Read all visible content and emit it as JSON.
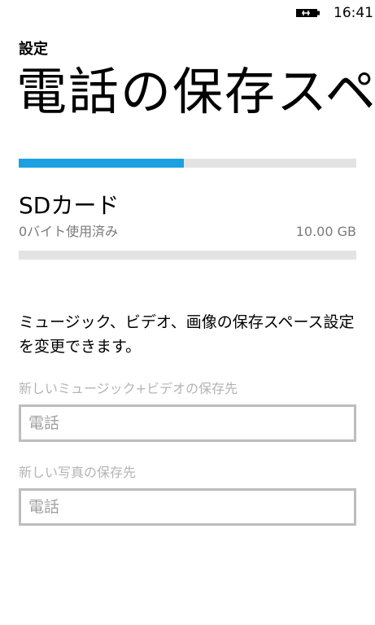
{
  "status_bar": {
    "battery_icon": "battery-charging-icon",
    "time": "16:41"
  },
  "header": {
    "app_title": "設定",
    "page_title": "電話の保存スペース"
  },
  "phone_storage": {
    "used_fraction": 0.49
  },
  "sd_card": {
    "title": "SDカード",
    "used": "0バイト使用済み",
    "capacity": "10.00 GB",
    "used_fraction": 0
  },
  "description": "ミュージック、ビデオ、画像の保存スペース設定を変更できます。",
  "settings": {
    "music_video_label": "新しいミュージック+ビデオの保存先",
    "music_video_value": "電話",
    "photo_label": "新しい写真の保存先",
    "photo_value": "電話"
  },
  "colors": {
    "accent": "#1ba1e2",
    "bar_track": "#e3e3e3"
  }
}
